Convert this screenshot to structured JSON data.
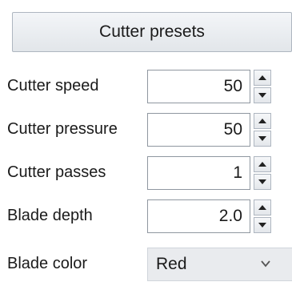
{
  "presets_button": {
    "label": "Cutter presets"
  },
  "rows": [
    {
      "label": "Cutter speed",
      "value": "50"
    },
    {
      "label": "Cutter pressure",
      "value": "50"
    },
    {
      "label": "Cutter passes",
      "value": "1"
    },
    {
      "label": "Blade depth",
      "value": "2.0"
    }
  ],
  "blade_color": {
    "label": "Blade color",
    "selected": "Red"
  },
  "icons": {
    "spinner_up": "triangle-up-icon",
    "spinner_down": "triangle-down-icon",
    "dropdown": "chevron-down-icon"
  }
}
